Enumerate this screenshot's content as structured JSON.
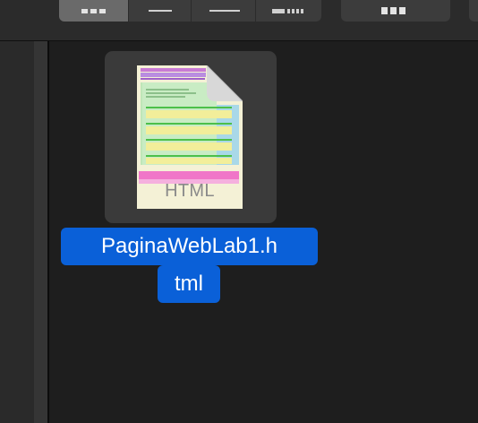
{
  "toolbar": {
    "view_buttons": [
      {
        "name": "icon-view",
        "icon": "grid-icon",
        "selected": true
      },
      {
        "name": "list-view",
        "icon": "list-icon",
        "selected": false
      },
      {
        "name": "column-view",
        "icon": "columns-icon",
        "selected": false
      },
      {
        "name": "gallery-view",
        "icon": "gallery-icon",
        "selected": false
      }
    ],
    "group_button_icon": "group-grid-icon"
  },
  "file": {
    "name_line1": "PaginaWebLab1.h",
    "name_line2": "tml",
    "type_label": "HTML",
    "selected": true
  },
  "colors": {
    "selection": "#0a60d8",
    "background": "#1e1e1e",
    "toolbar": "#2b2b2b",
    "icon_frame": "#3a3a3a"
  }
}
